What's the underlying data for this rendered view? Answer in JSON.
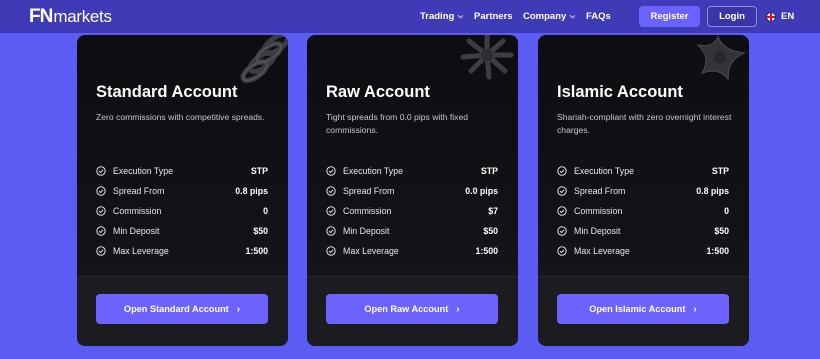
{
  "header": {
    "logo_fn": "FN",
    "logo_markets": "markets",
    "nav": [
      {
        "label": "Trading",
        "has_dropdown": true
      },
      {
        "label": "Partners",
        "has_dropdown": false
      },
      {
        "label": "Company",
        "has_dropdown": true
      },
      {
        "label": "FAQs",
        "has_dropdown": false
      }
    ],
    "register_label": "Register",
    "login_label": "Login",
    "language": "EN",
    "language_icon": "uk-flag-icon"
  },
  "colors": {
    "page_background": "#5b5cf4",
    "header_background": "#3f3ab5",
    "accent": "#6c63ff",
    "card_background": "#0e0e12"
  },
  "cards": [
    {
      "title": "Standard Account",
      "description": "Zero commissions with competitive spreads.",
      "decoration_icon": "spring-coil-icon",
      "features": [
        {
          "label": "Execution Type",
          "value": "STP"
        },
        {
          "label": "Spread From",
          "value": "0.8 pips"
        },
        {
          "label": "Commission",
          "value": "0"
        },
        {
          "label": "Min Deposit",
          "value": "$50"
        },
        {
          "label": "Max Leverage",
          "value": "1:500"
        }
      ],
      "button_label": "Open Standard Account"
    },
    {
      "title": "Raw Account",
      "description": "Tight spreads from 0.0 pips with fixed commissions.",
      "decoration_icon": "starburst-icon",
      "features": [
        {
          "label": "Execution Type",
          "value": "STP"
        },
        {
          "label": "Spread From",
          "value": "0.0 pips"
        },
        {
          "label": "Commission",
          "value": "$7"
        },
        {
          "label": "Min Deposit",
          "value": "$50"
        },
        {
          "label": "Max Leverage",
          "value": "1:500"
        }
      ],
      "button_label": "Open Raw Account"
    },
    {
      "title": "Islamic Account",
      "description": "Shariah-compliant with zero overnight interest charges.",
      "decoration_icon": "star-shape-icon",
      "features": [
        {
          "label": "Execution Type",
          "value": "STP"
        },
        {
          "label": "Spread From",
          "value": "0.8 pips"
        },
        {
          "label": "Commission",
          "value": "0"
        },
        {
          "label": "Min Deposit",
          "value": "$50"
        },
        {
          "label": "Max Leverage",
          "value": "1:500"
        }
      ],
      "button_label": "Open Islamic Account"
    }
  ]
}
